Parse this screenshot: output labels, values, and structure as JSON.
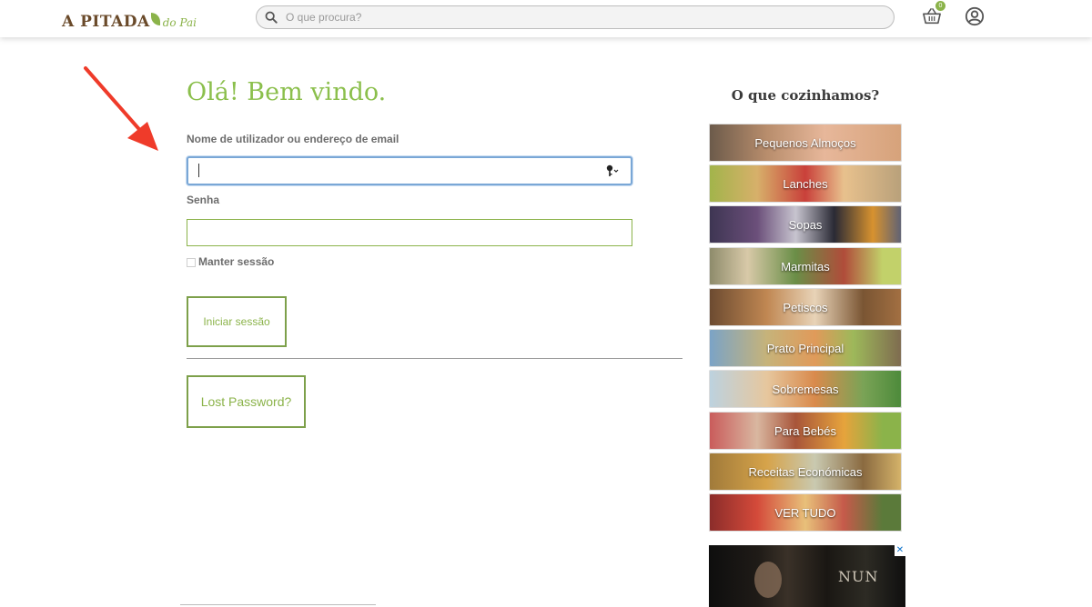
{
  "header": {
    "logo_main": "A PITADA",
    "logo_sub": "do Pai",
    "search_placeholder": "O que procura?",
    "cart_count": "0"
  },
  "login": {
    "title": "Olá! Bem vindo.",
    "username_label": "Nome de utilizador ou endereço de email",
    "username_value": "",
    "password_label": "Senha",
    "remember_label": "Manter sessão",
    "submit_label": "Iniciar sessão",
    "lost_password_label": "Lost Password?"
  },
  "sidebar": {
    "title": "O que cozinhamos?",
    "categories": [
      {
        "label": "Pequenos Almoços"
      },
      {
        "label": "Lanches"
      },
      {
        "label": "Sopas"
      },
      {
        "label": "Marmitas"
      },
      {
        "label": "Petiscos"
      },
      {
        "label": "Prato Principal"
      },
      {
        "label": "Sobremesas"
      },
      {
        "label": "Para Bebés"
      },
      {
        "label": "Receitas Económicas"
      },
      {
        "label": "VER TUDO"
      }
    ]
  },
  "ad": {
    "title": "NUN",
    "close_label": "✕"
  },
  "colors": {
    "accent_green": "#8bb34a",
    "annotation_arrow": "#ef3b2a"
  }
}
